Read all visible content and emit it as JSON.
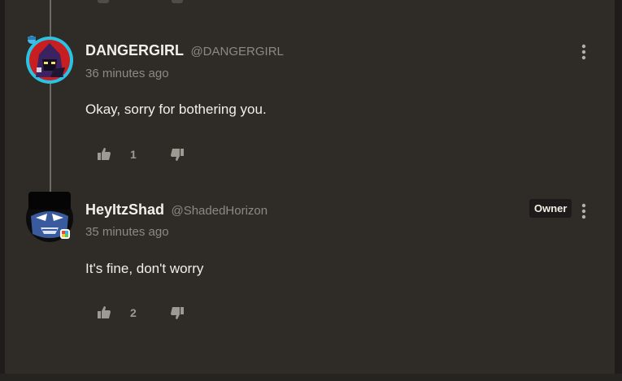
{
  "comments": [
    {
      "author": "DANGERGIRL",
      "handle": "@DANGERGIRL",
      "timestamp": "36 minutes ago",
      "body": "Okay, sorry for bothering you.",
      "likes": "1",
      "avatar_icon": "dark-hooded-character-avatar"
    },
    {
      "author": "HeyItzShad",
      "handle": "@ShadedHorizon",
      "timestamp": "35 minutes ago",
      "body": "It's fine, don't worry",
      "likes": "2",
      "badge": "Owner",
      "avatar_icon": "blue-hooded-character-avatar"
    }
  ],
  "icons": {
    "like": "thumbs-up-icon",
    "dislike": "thumbs-down-icon",
    "menu": "more-vertical-icon"
  },
  "colors": {
    "panel_bg": "#2f2c28",
    "text_primary": "#f2efe9",
    "text_muted": "#8d8881",
    "avatar_ring": "#29c4e3"
  }
}
